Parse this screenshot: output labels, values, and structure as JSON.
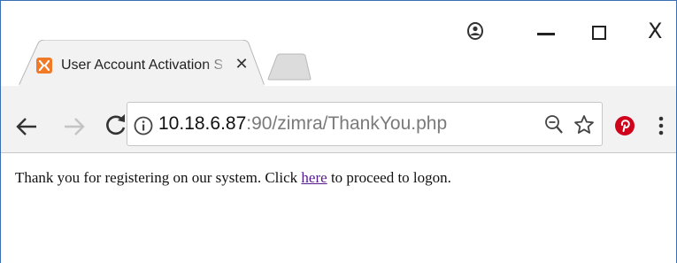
{
  "browser": {
    "tab": {
      "title": "User Account Activation S",
      "close_glyph": "✕"
    },
    "window_controls": {
      "close_glyph": "X"
    },
    "address_bar": {
      "url_host": "10.18.6.87",
      "url_rest": ":90/zimra/ThankYou.php"
    },
    "icons": {
      "favicon": "xampp-icon",
      "profile": "profile-icon",
      "back": "back-arrow-icon",
      "forward": "forward-arrow-icon",
      "reload": "reload-icon",
      "info": "info-icon",
      "zoom": "zoom-out-icon",
      "star": "bookmark-star-icon",
      "pinterest": "pinterest-icon",
      "menu": "kebab-menu-icon"
    },
    "colors": {
      "favicon_orange": "#f07a26",
      "pinterest_red": "#d0021b",
      "visited_link": "#551a8b"
    }
  },
  "page": {
    "message_before": "Thank you for registering on our system. Click ",
    "link_text": "here",
    "message_after": " to proceed to logon."
  }
}
